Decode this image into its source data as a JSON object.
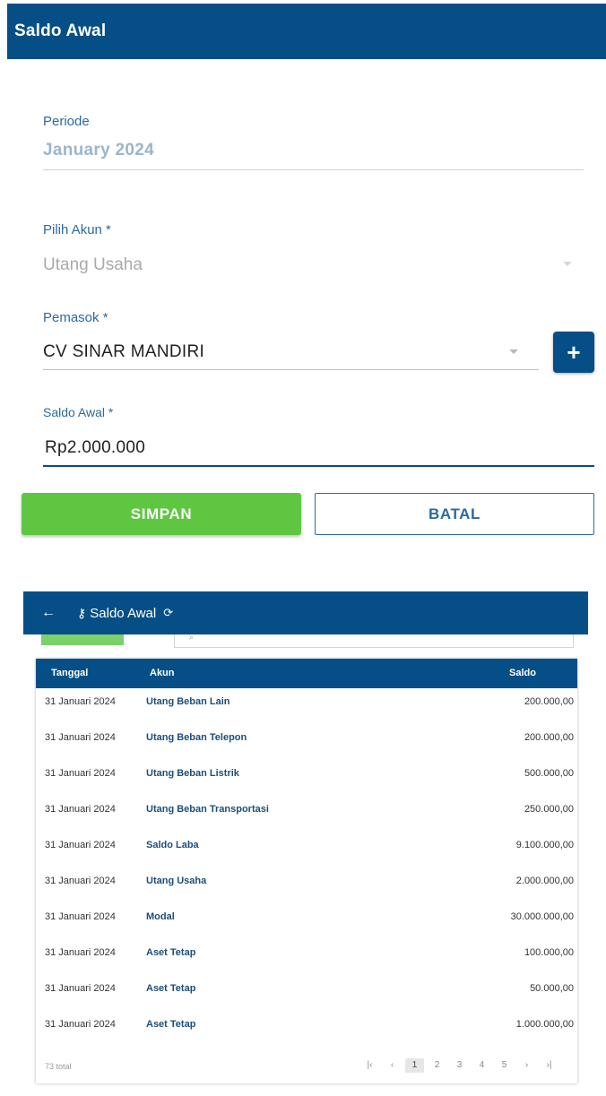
{
  "header": {
    "title": "Saldo Awal"
  },
  "form": {
    "periode_label": "Periode",
    "periode_value": "January 2024",
    "akun_label": "Pilih Akun *",
    "akun_value": "Utang Usaha",
    "pemasok_label": "Pemasok *",
    "pemasok_value": "CV SINAR MANDIRI",
    "saldo_label": "Saldo Awal *",
    "saldo_value": "Rp2.000.000",
    "add_symbol": "+",
    "save_label": "SIMPAN",
    "cancel_label": "BATAL"
  },
  "sub": {
    "back_icon": "arrow-left-icon",
    "key_icon": "key-icon",
    "refresh_icon": "refresh-icon",
    "title": "Saldo Awal",
    "table": {
      "headers": [
        "Tanggal",
        "Akun",
        "Saldo"
      ],
      "rows": [
        {
          "tanggal": "31 Januari 2024",
          "akun": "Utang Beban Lain",
          "saldo": "200.000,00"
        },
        {
          "tanggal": "31 Januari 2024",
          "akun": "Utang Beban Telepon",
          "saldo": "200.000,00"
        },
        {
          "tanggal": "31 Januari 2024",
          "akun": "Utang Beban Listrik",
          "saldo": "500.000,00"
        },
        {
          "tanggal": "31 Januari 2024",
          "akun": "Utang Beban Transportasi",
          "saldo": "250.000,00"
        },
        {
          "tanggal": "31 Januari 2024",
          "akun": "Saldo Laba",
          "saldo": "9.100.000,00"
        },
        {
          "tanggal": "31 Januari 2024",
          "akun": "Utang Usaha",
          "saldo": "2.000.000,00"
        },
        {
          "tanggal": "31 Januari 2024",
          "akun": "Modal",
          "saldo": "30.000.000,00"
        },
        {
          "tanggal": "31 Januari 2024",
          "akun": "Aset Tetap",
          "saldo": "100.000,00"
        },
        {
          "tanggal": "31 Januari 2024",
          "akun": "Aset Tetap",
          "saldo": "50.000,00"
        },
        {
          "tanggal": "31 Januari 2024",
          "akun": "Aset Tetap",
          "saldo": "1.000.000,00"
        }
      ]
    },
    "footer": {
      "total": "73 total",
      "pages": [
        "1",
        "2",
        "3",
        "4",
        "5"
      ],
      "active_page": "1",
      "first": "|‹",
      "prev": "‹",
      "next": "›",
      "last": "›|"
    }
  },
  "colors": {
    "primary": "#054f86",
    "save": "#5fc642",
    "label": "#2b6aa2"
  }
}
